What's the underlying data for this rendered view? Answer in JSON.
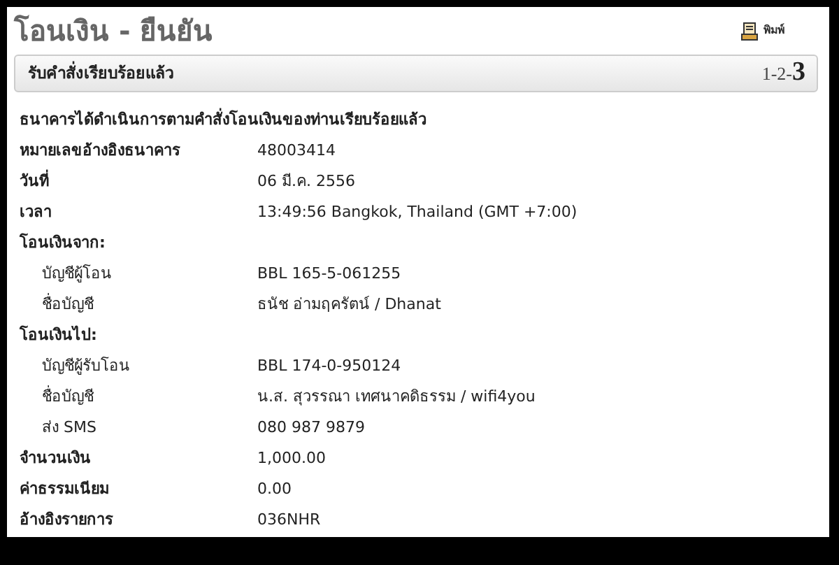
{
  "title": "โอนเงิน - ยืนยัน",
  "print_link": "พิมพ์",
  "status_bar": {
    "text": "รับคำสั่งเรียบร้อยแล้ว",
    "steps": "1-2-**3**"
  },
  "message": "ธนาคารได้ดำเนินการตามคำสั่งโอนเงินของท่านเรียบร้อยแล้ว",
  "details": [
    {
      "label": "หมายเลขอ้างอิงธนาคาร",
      "value": "48003414"
    },
    {
      "label": "วันที่",
      "value": "06 มี.ค. 2556"
    },
    {
      "label": "เวลา",
      "value": "13:49:56 Bangkok, Thailand (GMT +7:00)"
    },
    {
      "label": "โอนเงินจาก:",
      "children": [
        {
          "label": "บัญชีผู้โอน",
          "value": "BBL 165-5-061255"
        },
        {
          "label": "ชื่อบัญชี",
          "value": "ธนัช อ่ามฤครัตน์ / Dhanat"
        }
      ]
    },
    {
      "label": "โอนเงินไป:",
      "children": [
        {
          "label": "บัญชีผู้รับโอน",
          "value": "BBL 174-0-950124"
        },
        {
          "label": "ชื่อบัญชี",
          "value": "น.ส. สุวรรณา เทศนาคดิธรรม / wifi4you"
        },
        {
          "label": "ส่ง SMS",
          "value": "080 987 9879"
        }
      ]
    },
    {
      "label": "จำนวนเงิน",
      "value": "1,000.00"
    },
    {
      "label": "ค่าธรรมเนียม",
      "value": "0.00"
    },
    {
      "label": "อ้างอิงรายการ",
      "value": "036NHR"
    }
  ]
}
